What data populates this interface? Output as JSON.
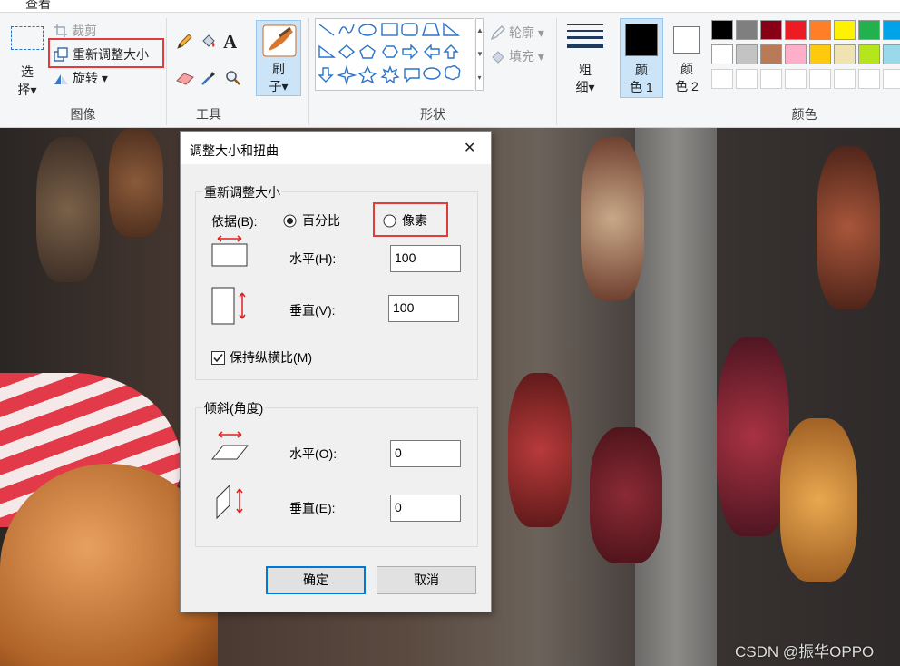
{
  "menu": {
    "view_tab": "查看"
  },
  "ribbon": {
    "image_group": {
      "label": "图像",
      "select": {
        "line1": "选",
        "line2": "择▾"
      },
      "crop": "裁剪",
      "resize": "重新调整大小",
      "rotate": "旋转 ▾"
    },
    "tools_group": {
      "label": "工具",
      "text_tool_glyph": "A"
    },
    "brushes": {
      "line1": "刷",
      "line2": "子▾"
    },
    "shapes_group": {
      "label": "形状",
      "outline": "轮廓 ▾",
      "fill": "填充 ▾"
    },
    "size": {
      "line1": "粗",
      "line2": "细▾"
    },
    "color1": {
      "line1": "颜",
      "line2": "色 1"
    },
    "color2": {
      "line1": "颜",
      "line2": "色 2"
    },
    "colors_group": {
      "label": "颜色",
      "row1": [
        "#000000",
        "#7f7f7f",
        "#880015",
        "#ed1c24",
        "#ff7f27",
        "#fff200",
        "#22b14c",
        "#00a2e8"
      ],
      "row2": [
        "#ffffff",
        "#c3c3c3",
        "#b97a57",
        "#ffaec9",
        "#ffc90e",
        "#efe4b0",
        "#b5e61d",
        "#99d9ea"
      ],
      "row3": [
        "#ffffff",
        "#ffffff",
        "#ffffff",
        "#ffffff",
        "#ffffff",
        "#ffffff",
        "#ffffff",
        "#ffffff"
      ]
    }
  },
  "dialog": {
    "title": "调整大小和扭曲",
    "close": "✕",
    "resize_section": "重新调整大小",
    "by_label": "依据(B):",
    "percent_option": "百分比",
    "pixels_option": "像素",
    "horizontal_label": "水平(H):",
    "horizontal_value": "100",
    "vertical_label": "垂直(V):",
    "vertical_value": "100",
    "keep_ratio_label": "保持纵横比(M)",
    "skew_section": "倾斜(角度)",
    "skew_h_label": "水平(O):",
    "skew_h_value": "0",
    "skew_v_label": "垂直(E):",
    "skew_v_value": "0",
    "ok": "确定",
    "cancel": "取消"
  },
  "watermark": "CSDN @振华OPPO"
}
